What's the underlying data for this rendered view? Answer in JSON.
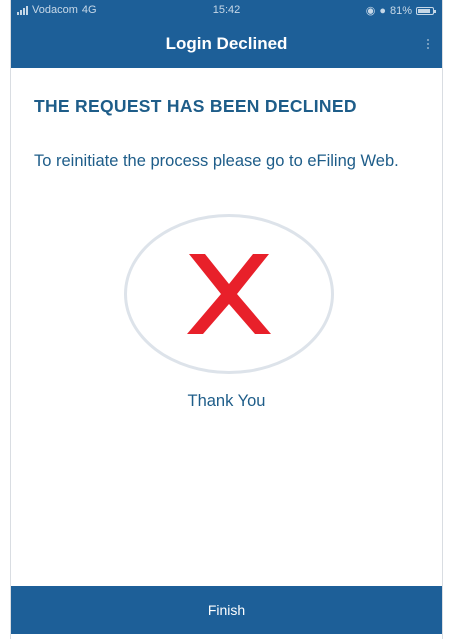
{
  "status_bar": {
    "carrier": "Vodacom",
    "network": "4G",
    "time": "15:42",
    "battery": "81%"
  },
  "header": {
    "title": "Login Declined"
  },
  "main": {
    "headline": "THE REQUEST HAS BEEN DECLINED",
    "message": "To reinitiate the process please go to eFiling Web.",
    "status_icon": "declined-x-icon",
    "thank_you": "Thank You"
  },
  "footer": {
    "finish_label": "Finish"
  },
  "colors": {
    "brand_blue": "#1d5f98",
    "text_blue": "#1e5d89",
    "decline_red": "#e8202a",
    "circle_border": "#dde3ea"
  }
}
